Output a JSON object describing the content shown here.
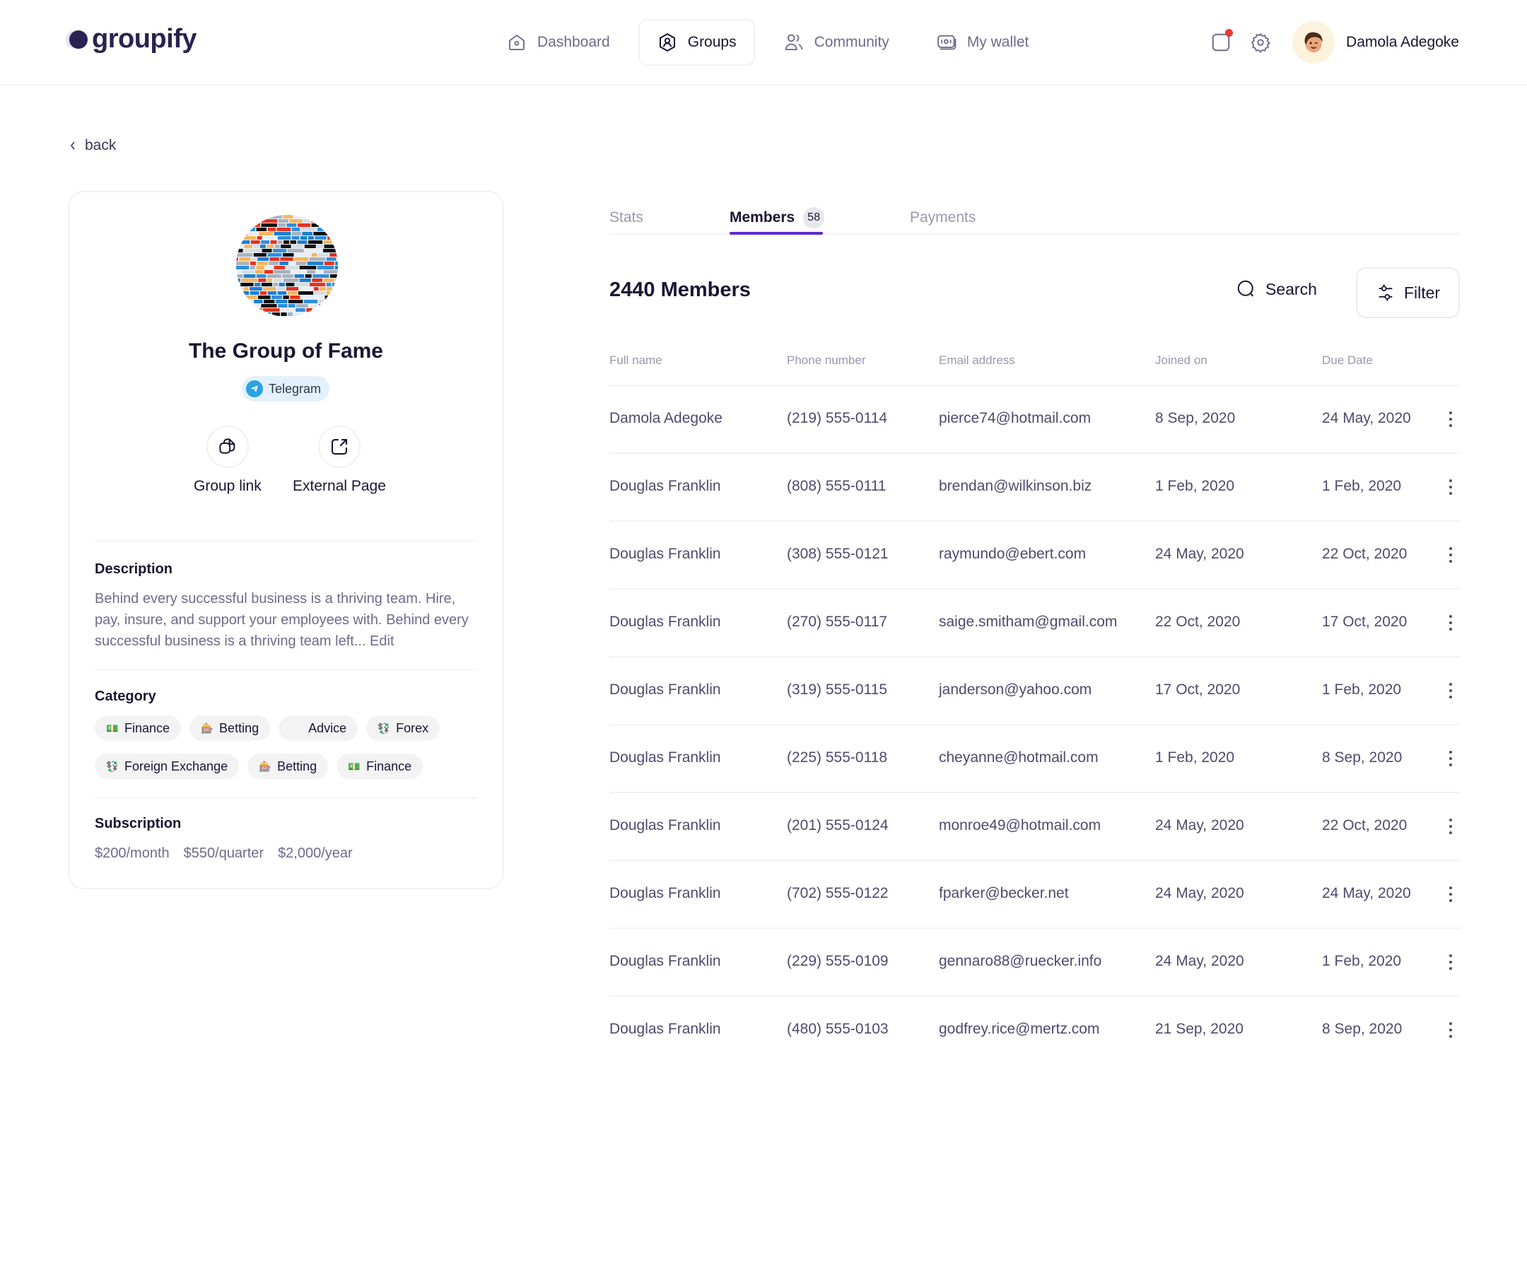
{
  "app": {
    "name": "groupify"
  },
  "nav": {
    "items": [
      {
        "label": "Dashboard",
        "icon": "home-icon",
        "active": false
      },
      {
        "label": "Groups",
        "icon": "user-shield-icon",
        "active": true
      },
      {
        "label": "Community",
        "icon": "users-icon",
        "active": false
      },
      {
        "label": "My wallet",
        "icon": "wallet-icon",
        "active": false
      }
    ]
  },
  "user": {
    "name": "Damola Adegoke",
    "has_notification": true
  },
  "back_label": "back",
  "group": {
    "name": "The Group of Fame",
    "platform": "Telegram",
    "actions": [
      {
        "label": "Group link",
        "icon": "copy-link-icon"
      },
      {
        "label": "External Page",
        "icon": "external-link-icon"
      }
    ],
    "description_title": "Description",
    "description": "Behind every successful business is a thriving team. Hire, pay, insure, and support your employees with. Behind every successful business is a thriving team left... Edit",
    "category_title": "Category",
    "categories": [
      {
        "label": "Finance",
        "icon": "💵"
      },
      {
        "label": "Betting",
        "icon": "🎰"
      },
      {
        "label": "Advice",
        "icon": ""
      },
      {
        "label": "Forex",
        "icon": "💱"
      },
      {
        "label": "Foreign Exchange",
        "icon": "💱"
      },
      {
        "label": "Betting",
        "icon": "🎰"
      },
      {
        "label": "Finance",
        "icon": "💵"
      }
    ],
    "subscription_title": "Subscription",
    "subscriptions": [
      "$200/month",
      "$550/quarter",
      "$2,000/year"
    ]
  },
  "tabs": [
    {
      "label": "Stats",
      "active": false
    },
    {
      "label": "Members",
      "active": true,
      "badge": "58"
    },
    {
      "label": "Payments",
      "active": false
    }
  ],
  "members": {
    "title": "2440 Members",
    "search_label": "Search",
    "filter_label": "Filter",
    "columns": [
      "Full name",
      "Phone number",
      "Email address",
      "Joined on",
      "Due Date"
    ],
    "rows": [
      {
        "name": "Damola Adegoke",
        "phone": "(219) 555-0114",
        "email": "pierce74@hotmail.com",
        "joined": "8 Sep, 2020",
        "due": "24 May, 2020"
      },
      {
        "name": "Douglas Franklin",
        "phone": "(808) 555-0111",
        "email": "brendan@wilkinson.biz",
        "joined": "1 Feb, 2020",
        "due": "1 Feb, 2020"
      },
      {
        "name": "Douglas Franklin",
        "phone": "(308) 555-0121",
        "email": "raymundo@ebert.com",
        "joined": "24 May, 2020",
        "due": "22 Oct, 2020"
      },
      {
        "name": "Douglas Franklin",
        "phone": "(270) 555-0117",
        "email": "saige.smitham@gmail.com",
        "joined": "22 Oct, 2020",
        "due": "17 Oct, 2020"
      },
      {
        "name": "Douglas Franklin",
        "phone": "(319) 555-0115",
        "email": "janderson@yahoo.com",
        "joined": "17 Oct, 2020",
        "due": "1 Feb, 2020"
      },
      {
        "name": "Douglas Franklin",
        "phone": "(225) 555-0118",
        "email": "cheyanne@hotmail.com",
        "joined": "1 Feb, 2020",
        "due": "8 Sep, 2020"
      },
      {
        "name": "Douglas Franklin",
        "phone": "(201) 555-0124",
        "email": "monroe49@hotmail.com",
        "joined": "24 May, 2020",
        "due": "22 Oct, 2020"
      },
      {
        "name": "Douglas Franklin",
        "phone": "(702) 555-0122",
        "email": "fparker@becker.net",
        "joined": "24 May, 2020",
        "due": "24 May, 2020"
      },
      {
        "name": "Douglas Franklin",
        "phone": "(229) 555-0109",
        "email": "gennaro88@ruecker.info",
        "joined": "24 May, 2020",
        "due": "1 Feb, 2020"
      },
      {
        "name": "Douglas Franklin",
        "phone": "(480) 555-0103",
        "email": "godfrey.rice@mertz.com",
        "joined": "21 Sep, 2020",
        "due": "8 Sep, 2020"
      }
    ]
  },
  "colors": {
    "accent": "#5b2bd1",
    "brand": "#2a2250",
    "notification": "#e23b33",
    "telegram": "#2aa3e0"
  }
}
